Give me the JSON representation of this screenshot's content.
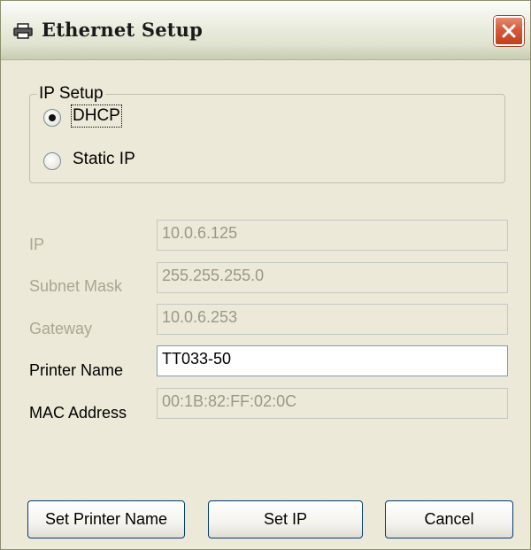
{
  "window": {
    "title": "Ethernet Setup"
  },
  "ip_setup": {
    "legend": "IP Setup",
    "options": [
      {
        "label": "DHCP",
        "checked": true
      },
      {
        "label": "Static IP",
        "checked": false
      }
    ]
  },
  "fields": [
    {
      "label": "IP",
      "value": "10.0.6.125",
      "enabled": false
    },
    {
      "label": "Subnet Mask",
      "value": "255.255.255.0",
      "enabled": false
    },
    {
      "label": "Gateway",
      "value": "10.0.6.253",
      "enabled": false
    },
    {
      "label": "Printer Name",
      "value": "TT033-50",
      "enabled": true
    },
    {
      "label": "MAC Address",
      "value": "00:1B:82:FF:02:0C",
      "enabled": false
    }
  ],
  "buttons": {
    "set_printer_name": "Set Printer Name",
    "set_ip": "Set IP",
    "cancel": "Cancel"
  },
  "colors": {
    "dialog_bg": "#ece9d8",
    "disabled_text": "#a9a790",
    "close_button": "#d55a3a"
  },
  "icons": {
    "title": "printer-icon",
    "close": "close-icon"
  }
}
